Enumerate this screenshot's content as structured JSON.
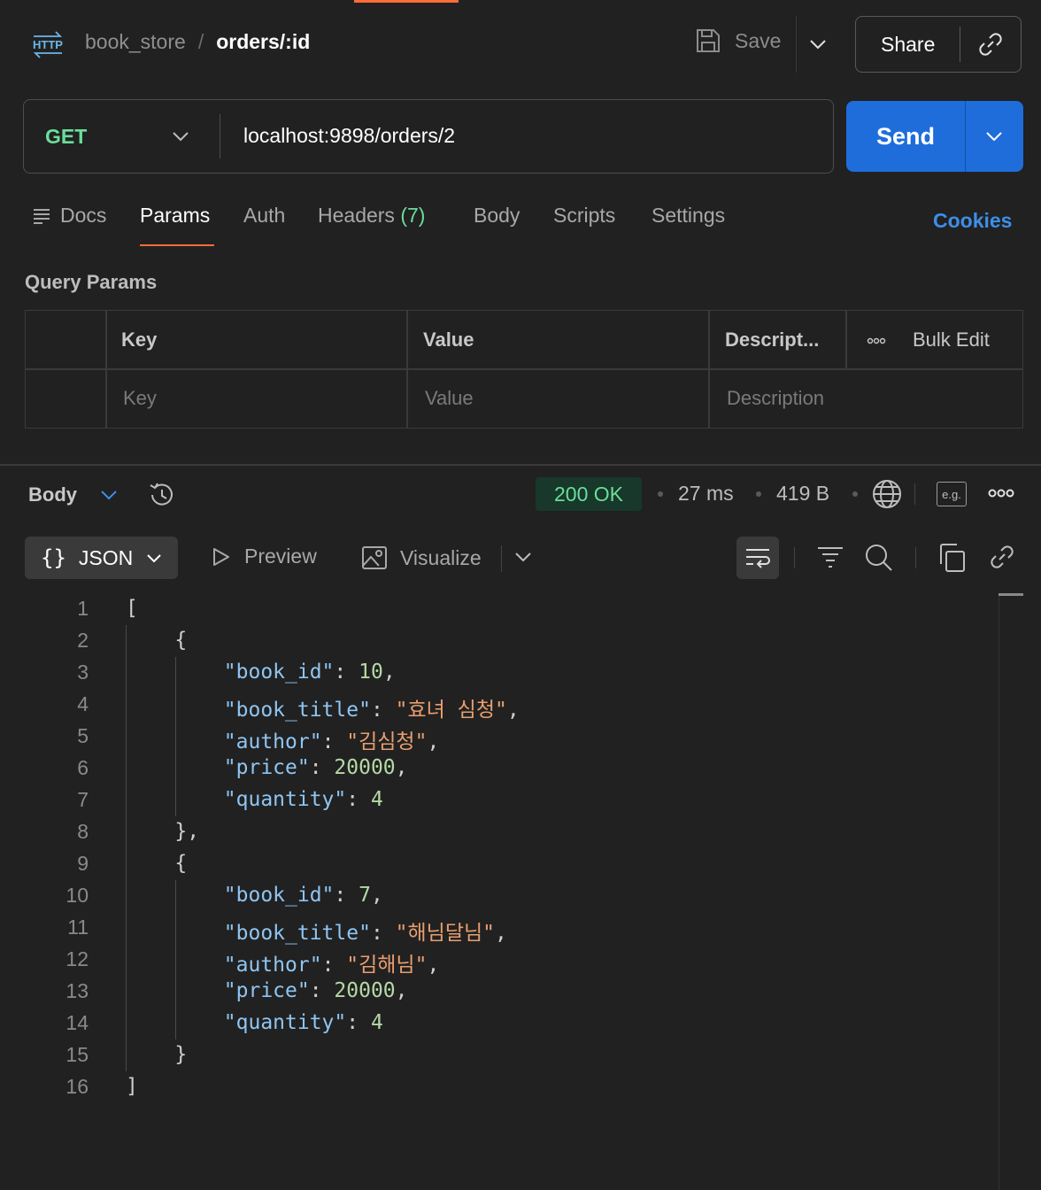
{
  "breadcrumb": {
    "collection": "book_store",
    "separator": "/",
    "request": "orders/:id"
  },
  "header": {
    "save_label": "Save",
    "share_label": "Share"
  },
  "request": {
    "method": "GET",
    "url": "localhost:9898/orders/2",
    "send_label": "Send"
  },
  "tabs": {
    "docs": "Docs",
    "params": "Params",
    "auth": "Auth",
    "headers": "Headers",
    "headers_count": "(7)",
    "body": "Body",
    "scripts": "Scripts",
    "settings": "Settings",
    "cookies": "Cookies",
    "active": "Params"
  },
  "query_params": {
    "title": "Query Params",
    "columns": {
      "key": "Key",
      "value": "Value",
      "description": "Descript...",
      "bulk_edit": "Bulk Edit"
    },
    "placeholders": {
      "key": "Key",
      "value": "Value",
      "description": "Description"
    }
  },
  "response": {
    "body_label": "Body",
    "status": "200 OK",
    "time": "27 ms",
    "size": "419 B",
    "example_label": "e.g.",
    "format": "JSON",
    "preview": "Preview",
    "visualize": "Visualize",
    "lines": [
      {
        "no": "1"
      },
      {
        "no": "2"
      },
      {
        "no": "3"
      },
      {
        "no": "4"
      },
      {
        "no": "5"
      },
      {
        "no": "6"
      },
      {
        "no": "7"
      },
      {
        "no": "8"
      },
      {
        "no": "9"
      },
      {
        "no": "10"
      },
      {
        "no": "11"
      },
      {
        "no": "12"
      },
      {
        "no": "13"
      },
      {
        "no": "14"
      },
      {
        "no": "15"
      },
      {
        "no": "16"
      }
    ],
    "json": [
      {
        "book_id": 10,
        "book_title": "효녀 심청",
        "author": "김심청",
        "price": 20000,
        "quantity": 4
      },
      {
        "book_id": 7,
        "book_title": "해님달님",
        "author": "김해님",
        "price": 20000,
        "quantity": 4
      }
    ]
  },
  "colors": {
    "accent": "#ff6c37",
    "send": "#1e6ddb",
    "method_get": "#6bdd9a",
    "status_ok": "#6bdd9a",
    "json_key": "#8fc5f2",
    "json_string": "#e89f6f",
    "json_number": "#b5d9a5"
  },
  "icons": {
    "http": "http-icon",
    "save": "save-icon",
    "link": "link-icon",
    "docs": "docs-icon",
    "history": "history-icon",
    "globe": "globe-icon",
    "more": "more-icon",
    "wrap": "wrap-lines-icon",
    "filter": "filter-icon",
    "search": "search-icon",
    "copy": "copy-icon"
  }
}
